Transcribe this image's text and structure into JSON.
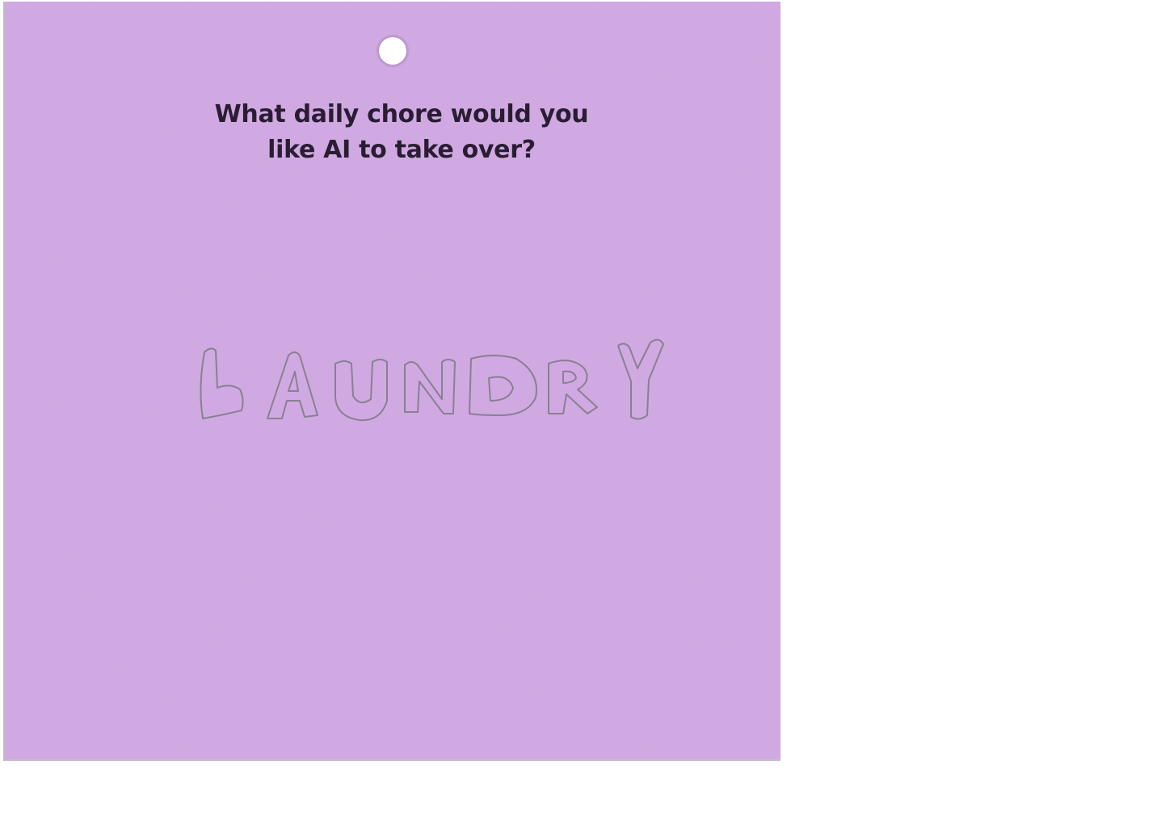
{
  "card": {
    "color": "#d2a9e4",
    "question_line_1": "What daily chore would you",
    "question_line_2": "like AI to take over?",
    "handwritten_answer": "LAUNDRY",
    "ink_color": "#8a7f93"
  }
}
